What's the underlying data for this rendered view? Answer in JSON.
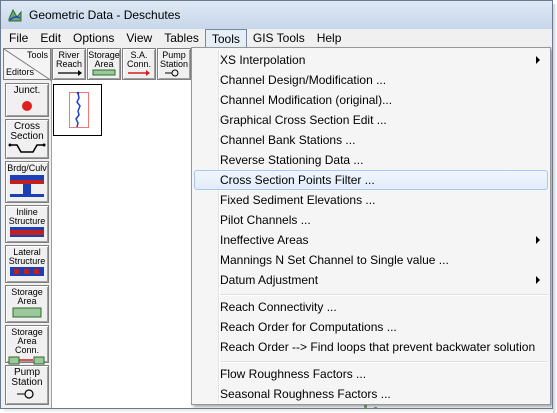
{
  "window": {
    "title": "Geometric Data - Deschutes"
  },
  "menubar": {
    "items": [
      "File",
      "Edit",
      "Options",
      "View",
      "Tables",
      "Tools",
      "GIS Tools",
      "Help"
    ],
    "active": "Tools"
  },
  "editors_tab": {
    "tools_label": "Tools",
    "editors_label": "Editors"
  },
  "left_tools": [
    {
      "label": "Junct."
    },
    {
      "label": "Cross Section"
    },
    {
      "label": "Brdg/Culv"
    },
    {
      "label": "Inline Structure"
    },
    {
      "label": "Lateral Structure"
    },
    {
      "label": "Storage Area"
    },
    {
      "label": "Storage Area Conn."
    },
    {
      "label": "Pump Station"
    }
  ],
  "top_tools": [
    {
      "label": "River Reach"
    },
    {
      "label": "Storage Area"
    },
    {
      "label": "S.A. Conn."
    },
    {
      "label": "Pump Station"
    }
  ],
  "tools_menu": [
    {
      "label": "XS Interpolation",
      "submenu": true
    },
    {
      "label": "Channel Design/Modification ..."
    },
    {
      "label": "Channel Modification (original)..."
    },
    {
      "label": "Graphical Cross Section Edit ..."
    },
    {
      "label": "Channel Bank Stations ..."
    },
    {
      "label": "Reverse Stationing Data ..."
    },
    {
      "label": "Cross Section Points Filter ...",
      "highlighted": true
    },
    {
      "label": "Fixed Sediment Elevations ..."
    },
    {
      "label": "Pilot Channels ..."
    },
    {
      "label": "Ineffective Areas",
      "submenu": true
    },
    {
      "label": "Mannings N Set Channel to Single value ..."
    },
    {
      "label": "Datum Adjustment",
      "submenu": true
    },
    {
      "label": "Reach Connectivity ...",
      "group_start": true
    },
    {
      "label": "Reach Order for Computations ..."
    },
    {
      "label": "Reach Order --> Find loops that prevent backwater solution ..."
    },
    {
      "label": "Flow Roughness Factors ...",
      "group_start": true
    },
    {
      "label": "Seasonal Roughness Factors ..."
    }
  ],
  "colors": {
    "highlight": "#e1ecf9",
    "river": "#1f3fd0",
    "flow_arrow": "#d02020"
  }
}
